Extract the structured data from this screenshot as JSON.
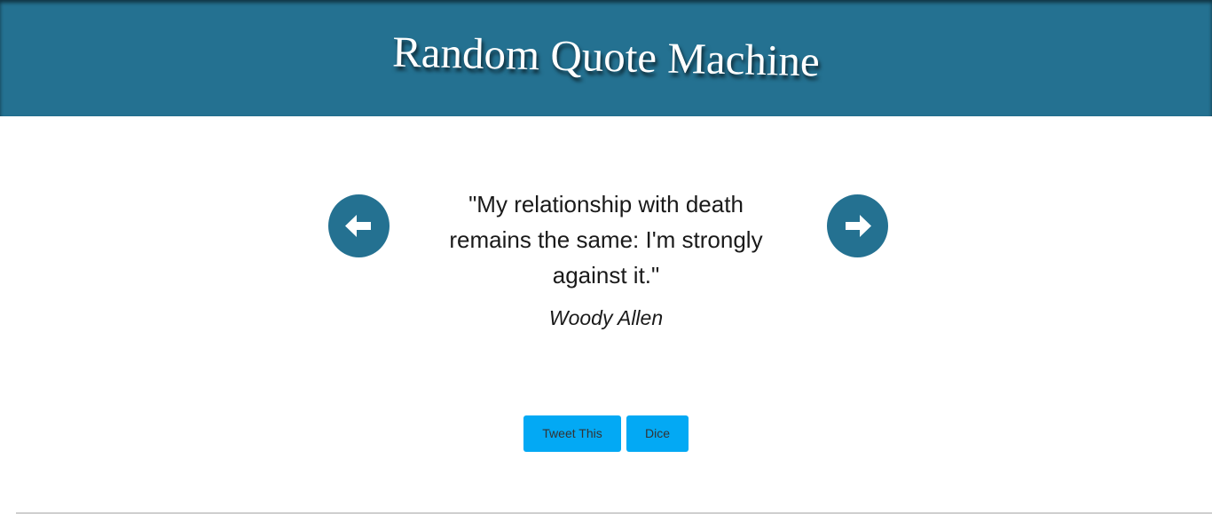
{
  "header": {
    "title": "Random Quote Machine",
    "background_color": "#247191"
  },
  "quote": {
    "text": "\"My relationship with death remains the same: I'm strongly against it.\"",
    "author": "Woody Allen"
  },
  "navigation": {
    "prev_icon": "arrow-left-icon",
    "next_icon": "arrow-right-icon"
  },
  "actions": {
    "tweet_label": "Tweet This",
    "dice_label": "Dice",
    "button_color": "#03a9f4"
  }
}
